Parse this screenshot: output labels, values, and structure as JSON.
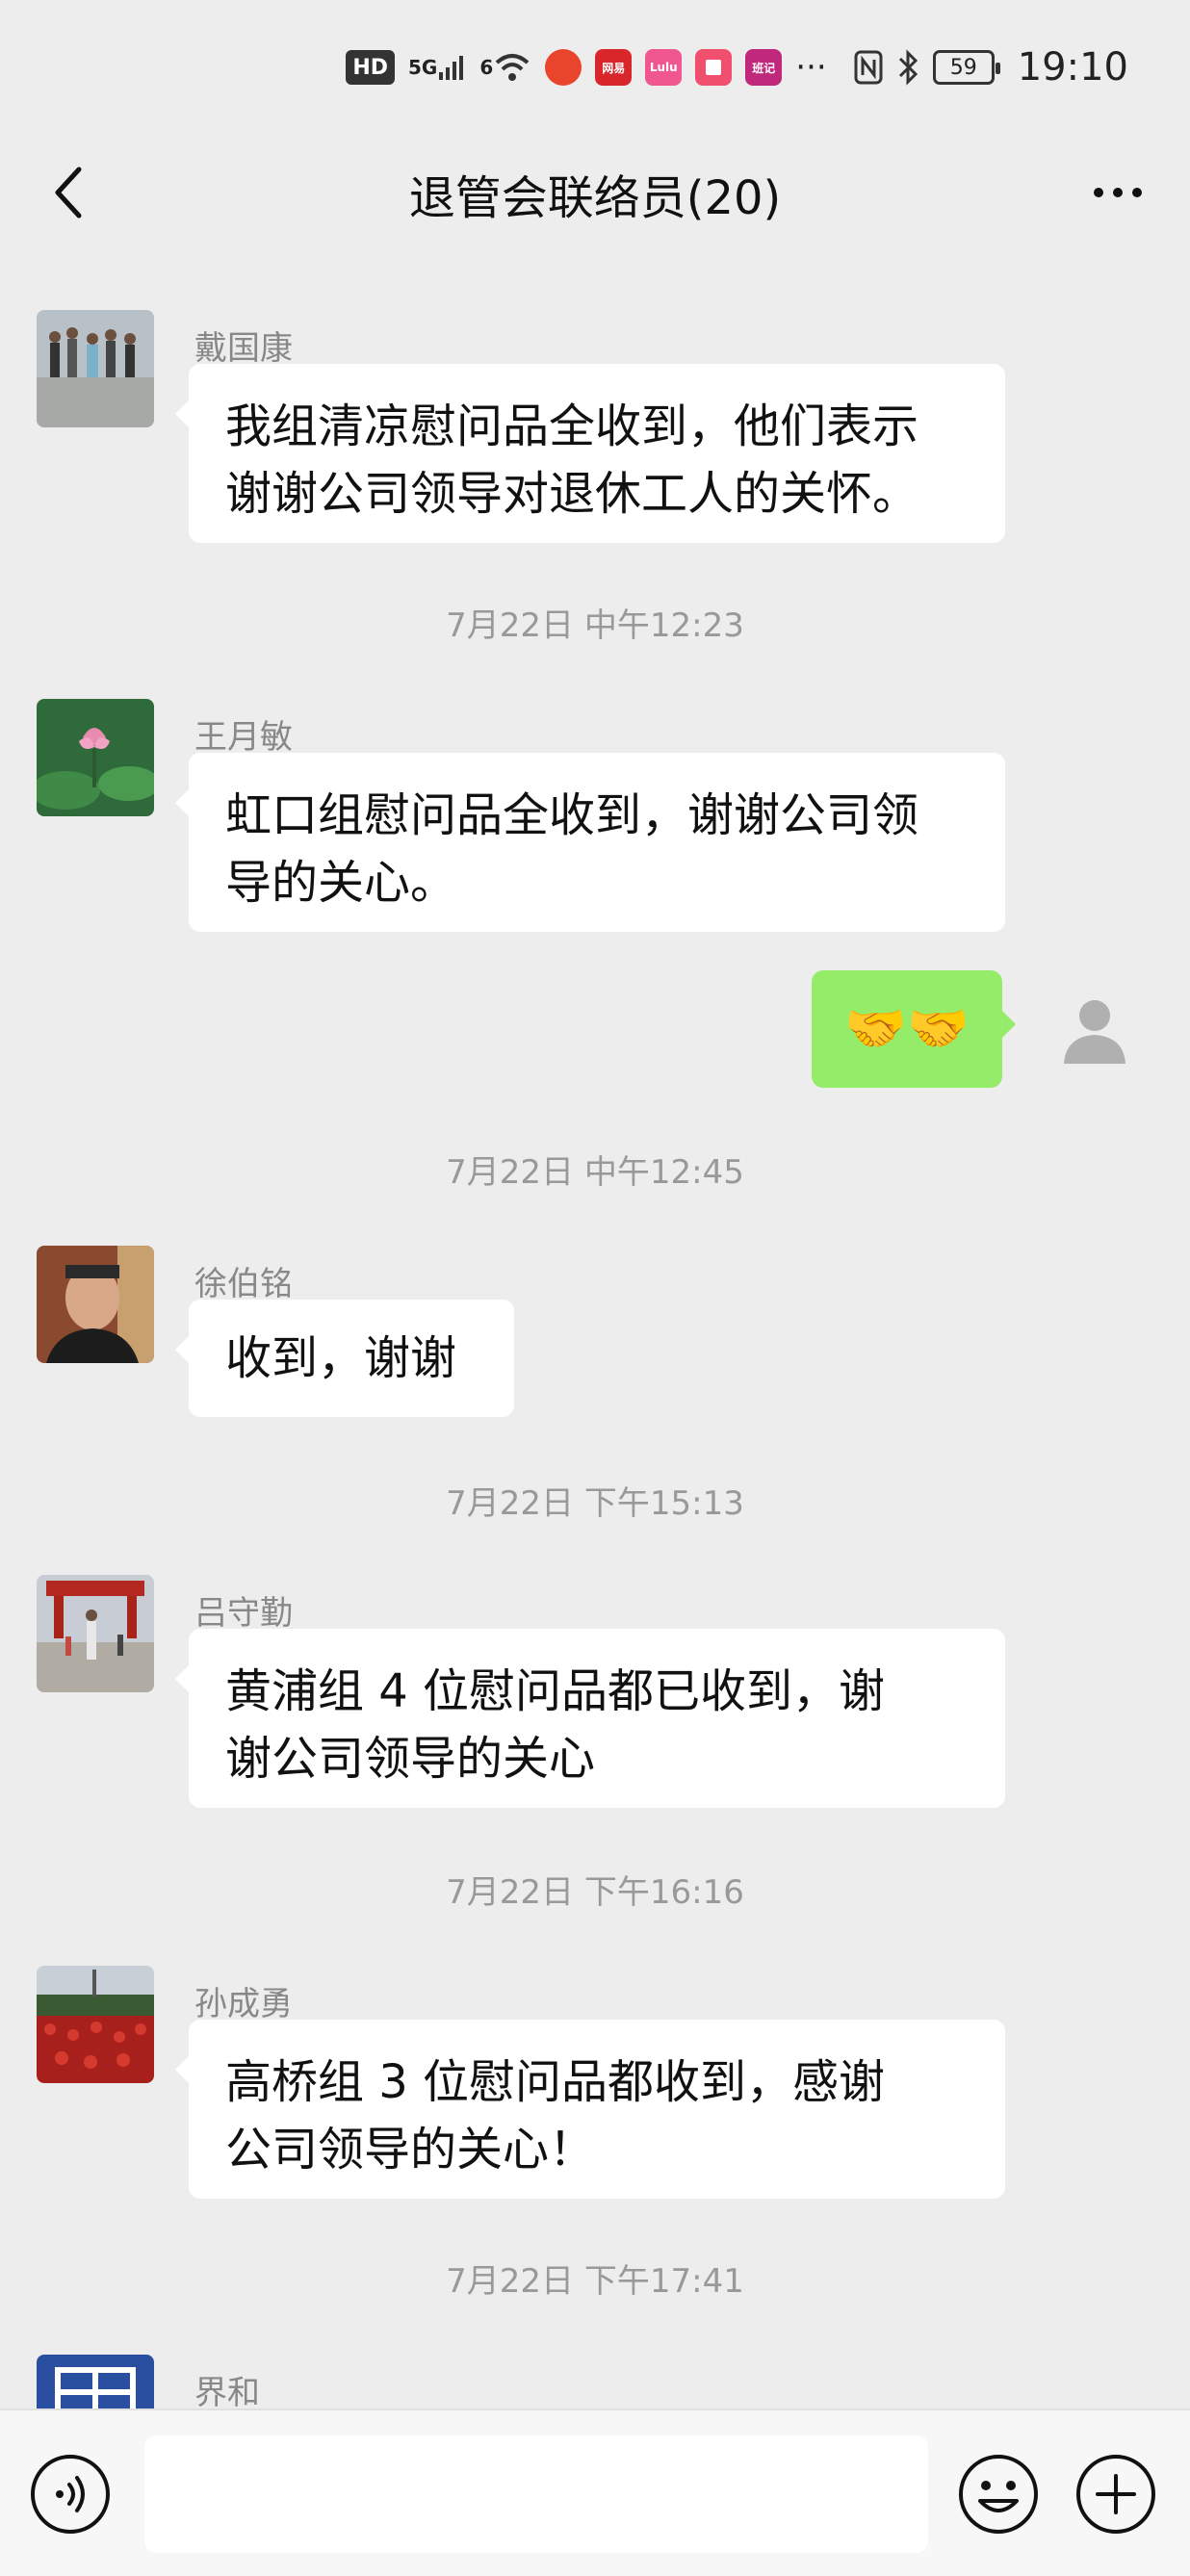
{
  "status_bar": {
    "hd": "HD",
    "net1": "5G",
    "net2": "6",
    "app_badge_1": "网易",
    "app_badge_2": "Lulu",
    "app_badge_3": "班记",
    "more": "···",
    "battery": "59",
    "time": "19:10"
  },
  "nav": {
    "title": "退管会联络员(20)"
  },
  "messages": [
    {
      "sender": "戴国康",
      "text_line1": "我组清凉慰问品全收到，他们表示",
      "text_line2": "谢谢公司领导对退休工人的关怀。"
    },
    {
      "timestamp": "7月22日 中午12:23"
    },
    {
      "sender": "王月敏",
      "text_line1": "虹口组慰问品全收到，谢谢公司领",
      "text_line2": "导的关心。"
    },
    {
      "self_emoji": "🤝🤝"
    },
    {
      "timestamp": "7月22日 中午12:45"
    },
    {
      "sender": "徐伯铭",
      "text_line1": "收到，谢谢"
    },
    {
      "timestamp": "7月22日 下午15:13"
    },
    {
      "sender": "吕守勤",
      "text_line1": "黄浦组 4 位慰问品都已收到，谢",
      "text_line2": "谢公司领导的关心"
    },
    {
      "timestamp": "7月22日 下午16:16"
    },
    {
      "sender": "孙成勇",
      "text_line1": "高桥组 3 位慰问品都收到，感谢",
      "text_line2": "公司领导的关心！"
    },
    {
      "timestamp": "7月22日 下午17:41"
    },
    {
      "sender": "界和"
    }
  ],
  "colors": {
    "background": "#ededed",
    "self_bubble": "#95ec69",
    "other_bubble": "#ffffff",
    "meta_text": "#999999"
  }
}
